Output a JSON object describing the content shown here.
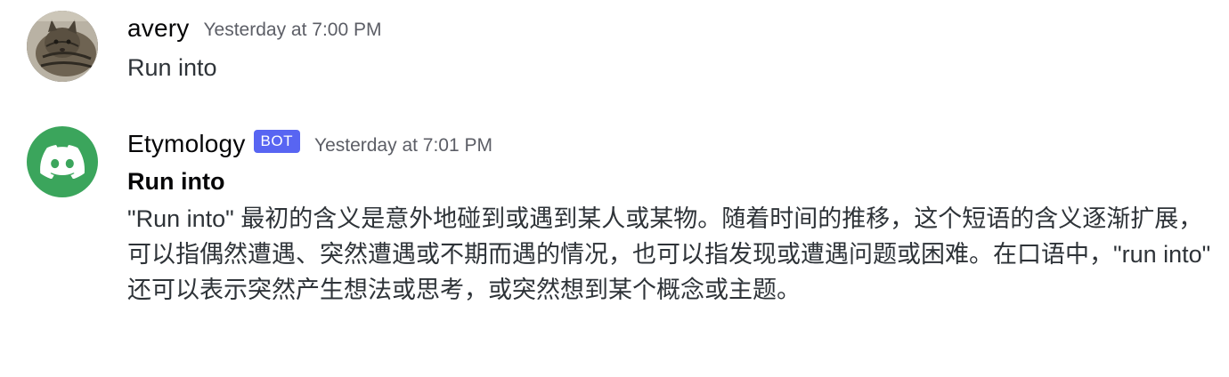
{
  "messages": [
    {
      "author": "avery",
      "timestamp": "Yesterday at 7:00 PM",
      "avatar_icon": "tabby-cat-photo-avatar",
      "text": "Run into"
    },
    {
      "author": "Etymology",
      "bot_tag": "BOT",
      "timestamp": "Yesterday at 7:01 PM",
      "avatar_icon": "discord-logo-avatar",
      "title": "Run into",
      "body": "\"Run into\" 最初的含义是意外地碰到或遇到某人或某物。随着时间的推移，这个短语的含义逐渐扩展，可以指偶然遭遇、突然遭遇或不期而遇的情况，也可以指发现或遭遇问题或困难。在口语中，\"run into\" 还可以表示突然产生想法或思考，或突然想到某个概念或主题。"
    }
  ],
  "colors": {
    "bot_tag_bg": "#5865f2",
    "discord_avatar_bg": "#3ba55c",
    "timestamp": "#5c5e66",
    "username": "#060607"
  }
}
